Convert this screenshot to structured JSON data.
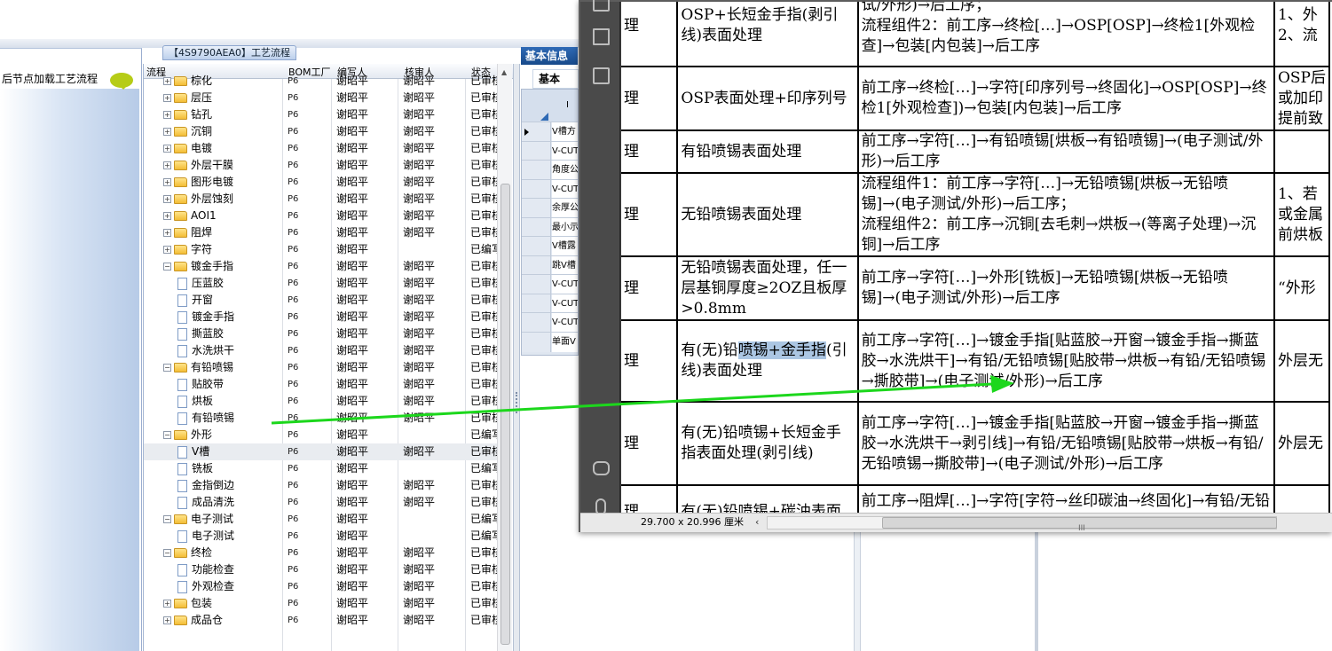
{
  "left_panel": {
    "node_label": "后节点加载工艺流程"
  },
  "tree_panel": {
    "title": "【4S9790AEA0】工艺流程",
    "headers": {
      "flow": "流程",
      "bom": "BOM工厂",
      "writer": "编写人",
      "reviewer": "核审人",
      "status": "状态"
    },
    "rows": [
      {
        "label": "棕化",
        "level": 0,
        "type": "folder",
        "bom": "P6",
        "writer": "谢昭平",
        "reviewer": "谢昭平",
        "status": "已审核"
      },
      {
        "label": "层压",
        "level": 0,
        "type": "folder",
        "bom": "P6",
        "writer": "谢昭平",
        "reviewer": "谢昭平",
        "status": "已审核"
      },
      {
        "label": "钻孔",
        "level": 0,
        "type": "folder",
        "bom": "P6",
        "writer": "谢昭平",
        "reviewer": "谢昭平",
        "status": "已审核"
      },
      {
        "label": "沉铜",
        "level": 0,
        "type": "folder",
        "bom": "P6",
        "writer": "谢昭平",
        "reviewer": "谢昭平",
        "status": "已审核"
      },
      {
        "label": "电镀",
        "level": 0,
        "type": "folder",
        "bom": "P6",
        "writer": "谢昭平",
        "reviewer": "谢昭平",
        "status": "已审核"
      },
      {
        "label": "外层干膜",
        "level": 0,
        "type": "folder",
        "bom": "P6",
        "writer": "谢昭平",
        "reviewer": "谢昭平",
        "status": "已审核"
      },
      {
        "label": "图形电镀",
        "level": 0,
        "type": "folder",
        "bom": "P6",
        "writer": "谢昭平",
        "reviewer": "谢昭平",
        "status": "已审核"
      },
      {
        "label": "外层蚀刻",
        "level": 0,
        "type": "folder",
        "bom": "P6",
        "writer": "谢昭平",
        "reviewer": "谢昭平",
        "status": "已审核"
      },
      {
        "label": "AOI1",
        "level": 0,
        "type": "folder",
        "bom": "P6",
        "writer": "谢昭平",
        "reviewer": "谢昭平",
        "status": "已审核"
      },
      {
        "label": "阻焊",
        "level": 0,
        "type": "folder",
        "bom": "P6",
        "writer": "谢昭平",
        "reviewer": "谢昭平",
        "status": "已审核"
      },
      {
        "label": "字符",
        "level": 0,
        "type": "folder",
        "bom": "P6",
        "writer": "谢昭平",
        "reviewer": "",
        "status": "已编写"
      },
      {
        "label": "镀金手指",
        "level": 0,
        "type": "folder-open",
        "bom": "P6",
        "writer": "谢昭平",
        "reviewer": "谢昭平",
        "status": "已审核"
      },
      {
        "label": "压蓝胶",
        "level": 1,
        "type": "doc",
        "bom": "P6",
        "writer": "谢昭平",
        "reviewer": "谢昭平",
        "status": "已审核"
      },
      {
        "label": "开窗",
        "level": 1,
        "type": "doc",
        "bom": "P6",
        "writer": "谢昭平",
        "reviewer": "谢昭平",
        "status": "已审核"
      },
      {
        "label": "镀金手指",
        "level": 1,
        "type": "doc",
        "bom": "P6",
        "writer": "谢昭平",
        "reviewer": "谢昭平",
        "status": "已审核"
      },
      {
        "label": "撕蓝胶",
        "level": 1,
        "type": "doc",
        "bom": "P6",
        "writer": "谢昭平",
        "reviewer": "谢昭平",
        "status": "已审核"
      },
      {
        "label": "水洗烘干",
        "level": 1,
        "type": "doc",
        "bom": "P6",
        "writer": "谢昭平",
        "reviewer": "谢昭平",
        "status": "已审核"
      },
      {
        "label": "有铅喷锡",
        "level": 0,
        "type": "folder-open",
        "bom": "P6",
        "writer": "谢昭平",
        "reviewer": "谢昭平",
        "status": "已审核"
      },
      {
        "label": "贴胶带",
        "level": 1,
        "type": "doc",
        "bom": "P6",
        "writer": "谢昭平",
        "reviewer": "谢昭平",
        "status": "已审核"
      },
      {
        "label": "烘板",
        "level": 1,
        "type": "doc",
        "bom": "P6",
        "writer": "谢昭平",
        "reviewer": "谢昭平",
        "status": "已审核"
      },
      {
        "label": "有铅喷锡",
        "level": 1,
        "type": "doc",
        "bom": "P6",
        "writer": "谢昭平",
        "reviewer": "谢昭平",
        "status": "已审核"
      },
      {
        "label": "外形",
        "level": 0,
        "type": "folder-open",
        "bom": "P6",
        "writer": "谢昭平",
        "reviewer": "",
        "status": "已编写"
      },
      {
        "label": "V槽",
        "level": 1,
        "type": "doc",
        "bom": "P6",
        "writer": "谢昭平",
        "reviewer": "谢昭平",
        "status": "已审核",
        "selected": true
      },
      {
        "label": "铣板",
        "level": 1,
        "type": "doc",
        "bom": "P6",
        "writer": "谢昭平",
        "reviewer": "",
        "status": "已编写"
      },
      {
        "label": "金指倒边",
        "level": 1,
        "type": "doc",
        "bom": "P6",
        "writer": "谢昭平",
        "reviewer": "谢昭平",
        "status": "已审核"
      },
      {
        "label": "成品清洗",
        "level": 1,
        "type": "doc",
        "bom": "P6",
        "writer": "谢昭平",
        "reviewer": "谢昭平",
        "status": "已审核"
      },
      {
        "label": "电子测试",
        "level": 0,
        "type": "folder-open",
        "bom": "P6",
        "writer": "谢昭平",
        "reviewer": "",
        "status": "已编写"
      },
      {
        "label": "电子测试",
        "level": 1,
        "type": "doc",
        "bom": "P6",
        "writer": "谢昭平",
        "reviewer": "",
        "status": "已编写"
      },
      {
        "label": "终检",
        "level": 0,
        "type": "folder-open",
        "bom": "P6",
        "writer": "谢昭平",
        "reviewer": "谢昭平",
        "status": "已审核"
      },
      {
        "label": "功能检查",
        "level": 1,
        "type": "doc",
        "bom": "P6",
        "writer": "谢昭平",
        "reviewer": "谢昭平",
        "status": "已审核"
      },
      {
        "label": "外观检查",
        "level": 1,
        "type": "doc",
        "bom": "P6",
        "writer": "谢昭平",
        "reviewer": "谢昭平",
        "status": "已审核"
      },
      {
        "label": "包装",
        "level": 0,
        "type": "folder",
        "bom": "P6",
        "writer": "谢昭平",
        "reviewer": "谢昭平",
        "status": "已审核"
      },
      {
        "label": "成品仓",
        "level": 0,
        "type": "folder",
        "bom": "P6",
        "writer": "谢昭平",
        "reviewer": "谢昭平",
        "status": "已审核"
      }
    ]
  },
  "basic_info": {
    "tab_label": "基本信息",
    "sub_label": "基本",
    "header_cell": "I",
    "items": [
      "V槽方",
      "V-CUT",
      "角度公",
      "V-CUT",
      "余厚公",
      "最小示",
      "V槽露",
      "跳V槽",
      "V-CUT",
      "V-CUT",
      "V-CUT",
      "单面V"
    ]
  },
  "pdf": {
    "status_size": "29.700 x 20.996 厘米",
    "nav_left": "‹",
    "grip": "III",
    "rows": [
      {
        "c0": "理",
        "c1": "OSP+长短金手指(剥引线)表面处理",
        "c2": "试/外形)→后工序；\n流程组件2：前工序→终检[…]→OSP[OSP]→终检1[外观检查]→包装[内包装]→后工序",
        "c3": "1、外\n2、流"
      },
      {
        "c0": "理",
        "c1": "OSP表面处理+印序列号",
        "c2": "前工序→终检[…]→字符[印序列号→终固化]→OSP[OSP]→终检1[外观检查])→包装[内包装]→后工序",
        "c3": "OSP后\n或加印\n提前致"
      },
      {
        "c0": "理",
        "c1": "有铅喷锡表面处理",
        "c2": "前工序→字符[…]→有铅喷锡[烘板→有铅喷锡]→(电子测试/外形)→后工序",
        "c3": ""
      },
      {
        "c0": "理",
        "c1": "无铅喷锡表面处理",
        "c2": "流程组件1：前工序→字符[…]→无铅喷锡[烘板→无铅喷锡]→(电子测试/外形)→后工序；\n流程组件2：前工序→沉铜[去毛刺→烘板→(等离子处理)→沉铜]→后工序",
        "c3": "1、若\n或金属\n前烘板"
      },
      {
        "c0": "理",
        "c1": "无铅喷锡表面处理，任一层基铜厚度≥2OZ且板厚>0.8mm",
        "c2": "前工序→字符[…]→外形[铣板]→无铅喷锡[烘板→无铅喷锡]→(电子测试/外形)→后工序",
        "c3": "“外形"
      },
      {
        "c0": "理",
        "c1a": "有(无)铅",
        "c1hl": "喷锡+金手指",
        "c1b": "(引线)表面处理",
        "c2": "前工序→字符[…]→镀金手指[贴蓝胶→开窗→镀金手指→撕蓝胶→水洗烘干]→有铅/无铅喷锡[贴胶带→烘板→有铅/无铅喷锡→撕胶带]→(电子测试/外形)→后工序",
        "c3": "外层无"
      },
      {
        "c0": "理",
        "c1": "有(无)铅喷锡+长短金手指表面处理(剥引线)",
        "c2": "前工序→字符[…]→镀金手指[贴蓝胶→开窗→镀金手指→撕蓝胶→水洗烘干→剥引线]→有铅/无铅喷锡[贴胶带→烘板→有铅/无铅喷锡→撕胶带]→(电子测试/外形)→后工序",
        "c3": "外层无"
      },
      {
        "c0": "理",
        "c1": "有(无)铅喷锡+碳油表面",
        "c2": "前工序→阻焊[…]→字符[字符→丝印碳油→终固化]→有铅/无铅喷锡[贴胶带→烘板→有铅/无铅喷锡→撕胶",
        "c3": ""
      }
    ]
  },
  "colors": {
    "arrow": "#1cd71c",
    "accent": "#1d5aa6",
    "highlight": "#abc6e3"
  }
}
